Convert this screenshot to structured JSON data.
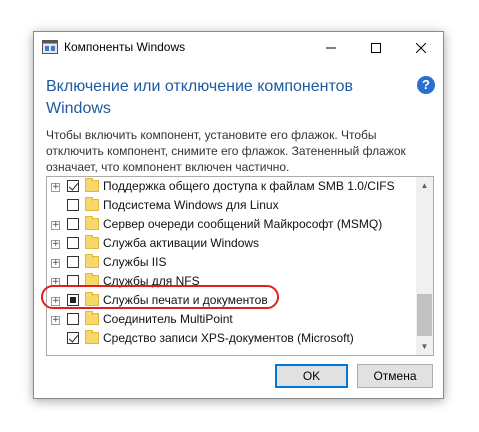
{
  "window": {
    "title": "Компоненты Windows"
  },
  "heading": "Включение или отключение компонентов Windows",
  "help_symbol": "?",
  "description": "Чтобы включить компонент, установите его флажок. Чтобы отключить компонент, снимите его флажок. Затененный флажок означает, что компонент включен частично.",
  "features": [
    {
      "label": "Поддержка общего доступа к файлам SMB 1.0/CIFS",
      "expandable": true,
      "state": "checked"
    },
    {
      "label": "Подсистема Windows для Linux",
      "expandable": false,
      "state": "unchecked"
    },
    {
      "label": "Сервер очереди сообщений Майкрософт (MSMQ)",
      "expandable": true,
      "state": "unchecked"
    },
    {
      "label": "Служба активации Windows",
      "expandable": true,
      "state": "unchecked"
    },
    {
      "label": "Службы IIS",
      "expandable": true,
      "state": "unchecked"
    },
    {
      "label": "Службы для NFS",
      "expandable": true,
      "state": "unchecked"
    },
    {
      "label": "Службы печати и документов",
      "expandable": true,
      "state": "partial",
      "highlighted": true
    },
    {
      "label": "Соединитель MultiPoint",
      "expandable": true,
      "state": "unchecked"
    },
    {
      "label": "Средство записи XPS-документов (Microsoft)",
      "expandable": false,
      "state": "checked"
    }
  ],
  "buttons": {
    "ok": "OK",
    "cancel": "Отмена"
  },
  "colors": {
    "heading": "#1e5aa0",
    "highlight": "#e02020",
    "accent": "#0078d7"
  }
}
